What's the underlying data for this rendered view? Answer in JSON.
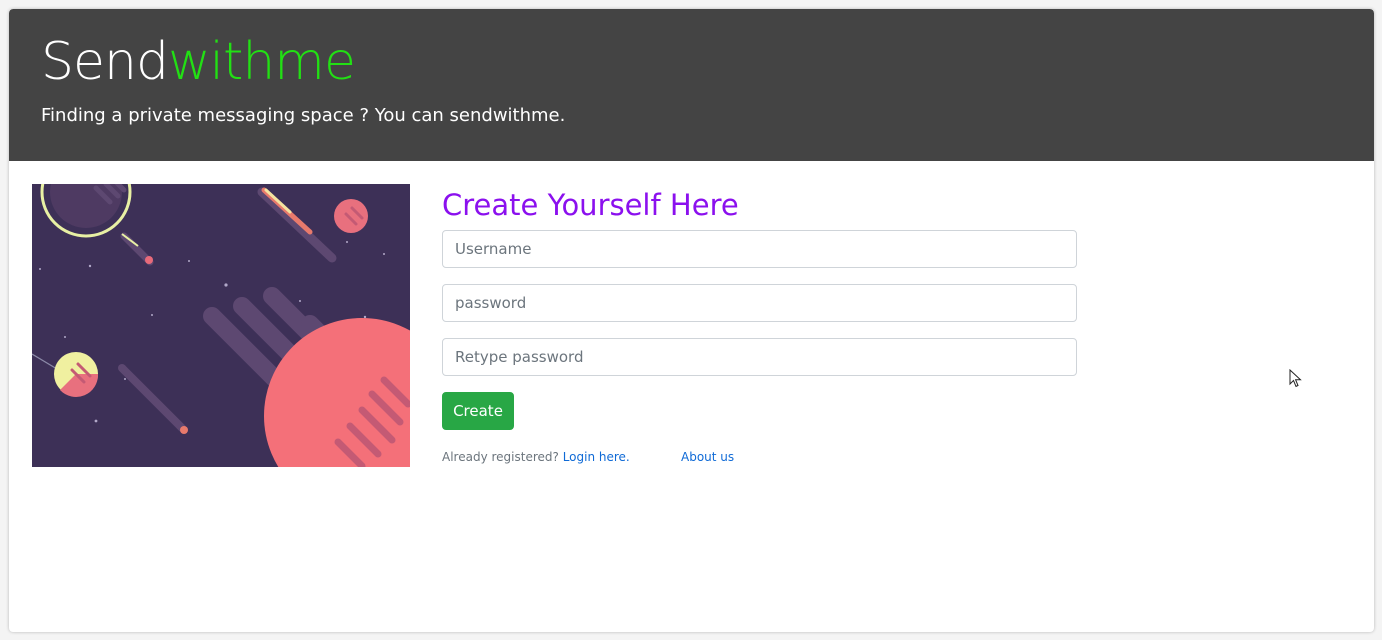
{
  "header": {
    "brand_plain": "Send",
    "brand_accent": "withme",
    "tagline": "Finding a private messaging space ? You can sendwithme."
  },
  "colors": {
    "header_bg": "#444444",
    "brand_accent": "#22e014",
    "form_title": "#8b10ee",
    "create_button": "#28a745",
    "link": "#0f6ad6"
  },
  "illustration": {
    "icon": "space-planets-illustration"
  },
  "form": {
    "title": "Create Yourself Here",
    "username_placeholder": "Username",
    "password_placeholder": "password",
    "retype_placeholder": "Retype password",
    "create_label": "Create"
  },
  "footer": {
    "registered_text": "Already registered?",
    "login_link": "Login here.",
    "about_link": "About us"
  }
}
